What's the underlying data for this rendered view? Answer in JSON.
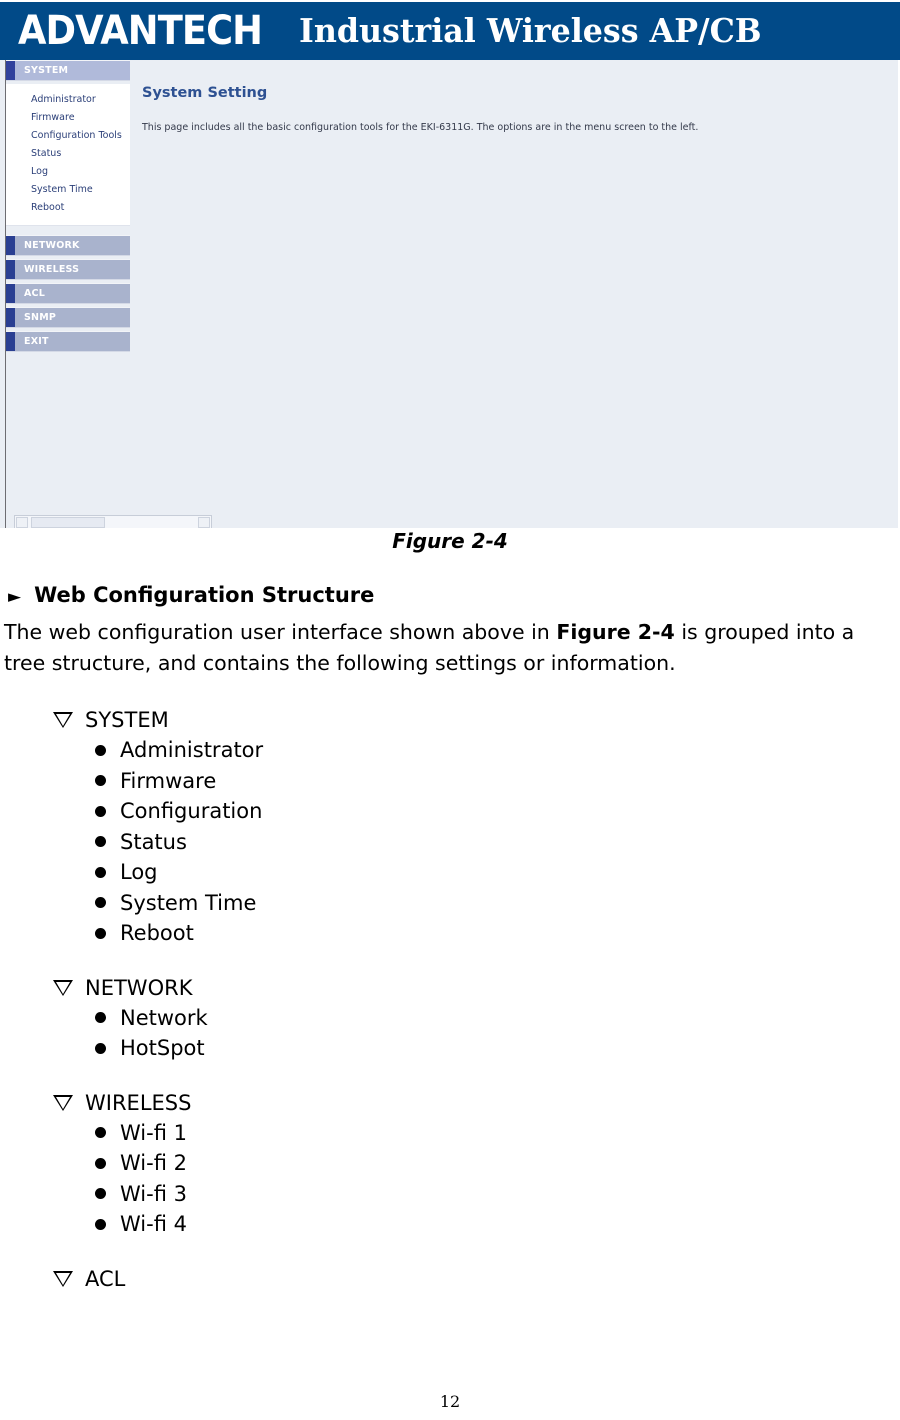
{
  "figure": {
    "caption": "Figure 2-4",
    "header": {
      "brand": "ADVANTECH",
      "title": "Industrial Wireless AP/CB",
      "background_color": "#014a88"
    },
    "sidebar": {
      "groups": [
        {
          "label": "SYSTEM",
          "active": true,
          "items": [
            "Administrator",
            "Firmware",
            "Configuration Tools",
            "Status",
            "Log",
            "System Time",
            "Reboot"
          ]
        },
        {
          "label": "NETWORK",
          "active": false,
          "items": []
        },
        {
          "label": "WIRELESS",
          "active": false,
          "items": []
        },
        {
          "label": "ACL",
          "active": false,
          "items": []
        },
        {
          "label": "SNMP",
          "active": false,
          "items": []
        },
        {
          "label": "EXIT",
          "active": false,
          "items": []
        }
      ],
      "tab_color": "#2a3f92",
      "button_color": "#a9b3cd"
    },
    "content": {
      "title": "System Setting",
      "description": "This page includes all the basic configuration tools for the EKI-6311G. The options are in the menu screen to the left.",
      "title_color": "#2e5192",
      "background_color": "#eaeef4"
    }
  },
  "document": {
    "section": {
      "marker": "►",
      "heading": "Web Configuration Structure"
    },
    "paragraph": {
      "before": "The web configuration user interface shown above in ",
      "emphasis": "Figure 2-4",
      "after": " is grouped into a tree structure, and contains the following settings or information."
    },
    "tree": [
      {
        "label": "SYSTEM",
        "items": [
          "Administrator",
          "Firmware",
          "Configuration",
          "Status",
          "Log",
          "System Time",
          "Reboot"
        ]
      },
      {
        "label": "NETWORK",
        "items": [
          "Network",
          "HotSpot"
        ]
      },
      {
        "label": "WIRELESS",
        "items": [
          "Wi-fi 1",
          "Wi-fi 2",
          "Wi-fi 3",
          "Wi-fi 4"
        ]
      },
      {
        "label": "ACL",
        "items": []
      }
    ],
    "page_number": "12"
  }
}
